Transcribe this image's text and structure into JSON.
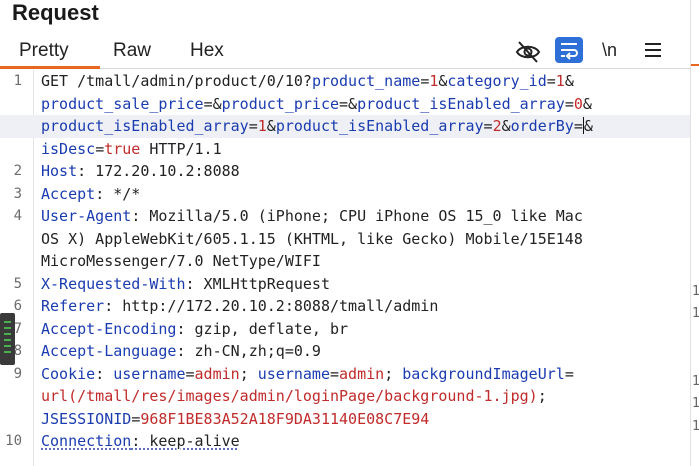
{
  "panel": {
    "title": "Request"
  },
  "tabs": [
    {
      "label": "Pretty",
      "active": true
    },
    {
      "label": "Raw",
      "active": false
    },
    {
      "label": "Hex",
      "active": false
    }
  ],
  "toolbar": {
    "hide_icon": "eye-slash-icon",
    "wrap_icon": "word-wrap-icon",
    "newline_label": "\\n",
    "menu_icon": "hamburger-menu-icon",
    "wrap_active_color": "#2e6fd8"
  },
  "colors": {
    "accent": "#e8661f",
    "key": "#1b3cb0",
    "value": "#c12b2b"
  },
  "request_lines": [
    {
      "number": "1",
      "rows": [
        [
          {
            "t": "p",
            "s": "GET /tmall/admin/product/0/10?"
          },
          {
            "t": "k",
            "s": "product_name"
          },
          {
            "t": "p",
            "s": "="
          },
          {
            "t": "v",
            "s": "1"
          },
          {
            "t": "p",
            "s": "&"
          },
          {
            "t": "k",
            "s": "category_id"
          },
          {
            "t": "p",
            "s": "="
          },
          {
            "t": "v",
            "s": "1"
          },
          {
            "t": "p",
            "s": "&"
          }
        ],
        [
          {
            "t": "k",
            "s": "product_sale_price"
          },
          {
            "t": "p",
            "s": "=&"
          },
          {
            "t": "k",
            "s": "product_price"
          },
          {
            "t": "p",
            "s": "=&"
          },
          {
            "t": "k",
            "s": "product_isEnabled_array"
          },
          {
            "t": "p",
            "s": "="
          },
          {
            "t": "v",
            "s": "0"
          },
          {
            "t": "p",
            "s": "&"
          }
        ],
        [
          {
            "t": "k",
            "s": "product_isEnabled_array"
          },
          {
            "t": "p",
            "s": "="
          },
          {
            "t": "v",
            "s": "1"
          },
          {
            "t": "p",
            "s": "&"
          },
          {
            "t": "k",
            "s": "product_isEnabled_array"
          },
          {
            "t": "p",
            "s": "="
          },
          {
            "t": "v",
            "s": "2"
          },
          {
            "t": "p",
            "s": "&"
          },
          {
            "t": "k",
            "s": "orderBy"
          },
          {
            "t": "p",
            "s": "="
          },
          {
            "t": "cursor",
            "s": ""
          },
          {
            "t": "p",
            "s": "&"
          }
        ],
        [
          {
            "t": "k",
            "s": "isDesc"
          },
          {
            "t": "p",
            "s": "="
          },
          {
            "t": "v",
            "s": "true"
          },
          {
            "t": "p",
            "s": " HTTP/1.1"
          }
        ]
      ]
    },
    {
      "number": "2",
      "rows": [
        [
          {
            "t": "k",
            "s": "Host"
          },
          {
            "t": "p",
            "s": ": 172.20.10.2:8088"
          }
        ]
      ]
    },
    {
      "number": "3",
      "rows": [
        [
          {
            "t": "k",
            "s": "Accept"
          },
          {
            "t": "p",
            "s": ": */*"
          }
        ]
      ]
    },
    {
      "number": "4",
      "rows": [
        [
          {
            "t": "k",
            "s": "User-Agent"
          },
          {
            "t": "p",
            "s": ": Mozilla/5.0 (iPhone; CPU iPhone OS 15_0 like Mac"
          }
        ],
        [
          {
            "t": "p",
            "s": "OS X) AppleWebKit/605.1.15 (KHTML, like Gecko) Mobile/15E148"
          }
        ],
        [
          {
            "t": "p",
            "s": "MicroMessenger/7.0 NetType/WIFI"
          }
        ]
      ]
    },
    {
      "number": "5",
      "rows": [
        [
          {
            "t": "k",
            "s": "X-Requested-With"
          },
          {
            "t": "p",
            "s": ": XMLHttpRequest"
          }
        ]
      ]
    },
    {
      "number": "6",
      "rows": [
        [
          {
            "t": "k",
            "s": "Referer"
          },
          {
            "t": "p",
            "s": ": http://172.20.10.2:8088/tmall/admin"
          }
        ]
      ]
    },
    {
      "number": "7",
      "rows": [
        [
          {
            "t": "k",
            "s": "Accept-Encoding"
          },
          {
            "t": "p",
            "s": ": gzip, deflate, br"
          }
        ]
      ]
    },
    {
      "number": "8",
      "rows": [
        [
          {
            "t": "k",
            "s": "Accept-Language"
          },
          {
            "t": "p",
            "s": ": zh-CN,zh;q=0.9"
          }
        ]
      ]
    },
    {
      "number": "9",
      "rows": [
        [
          {
            "t": "k",
            "s": "Cookie"
          },
          {
            "t": "p",
            "s": ": "
          },
          {
            "t": "k",
            "s": "username"
          },
          {
            "t": "p",
            "s": "="
          },
          {
            "t": "v",
            "s": "admin"
          },
          {
            "t": "p",
            "s": "; "
          },
          {
            "t": "k",
            "s": "username"
          },
          {
            "t": "p",
            "s": "="
          },
          {
            "t": "v",
            "s": "admin"
          },
          {
            "t": "p",
            "s": "; "
          },
          {
            "t": "k",
            "s": "backgroundImageUrl"
          },
          {
            "t": "p",
            "s": "="
          }
        ],
        [
          {
            "t": "v",
            "s": "url(/tmall/res/images/admin/loginPage/background-1.jpg)"
          },
          {
            "t": "p",
            "s": ";"
          }
        ],
        [
          {
            "t": "k",
            "s": "JSESSIONID"
          },
          {
            "t": "p",
            "s": "="
          },
          {
            "t": "v",
            "s": "968F1BE83A52A18F9DA31140E08C7E94"
          }
        ]
      ]
    },
    {
      "number": "10",
      "rows": [
        [
          {
            "t": "k",
            "s": "Connection",
            "u": true
          },
          {
            "t": "p",
            "s": ": keep-alive",
            "u": true
          }
        ]
      ]
    }
  ],
  "right_panel_numbers": [
    "1",
    "1",
    "1",
    "1",
    "1"
  ]
}
